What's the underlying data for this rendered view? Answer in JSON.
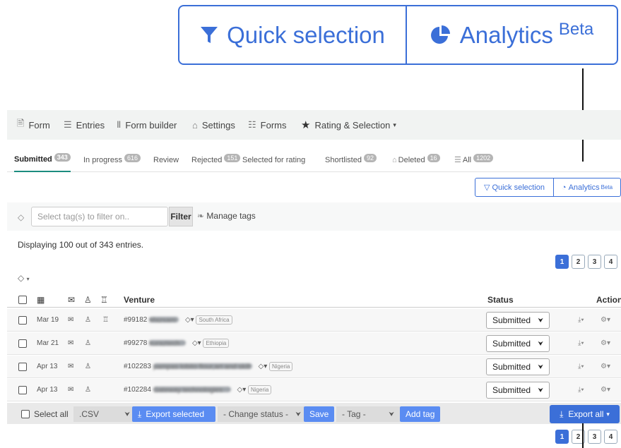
{
  "callout": {
    "quick_selection": "Quick selection",
    "analytics": "Analytics",
    "beta": "Beta"
  },
  "topnav": [
    {
      "label": "Form",
      "icon": "form-icon"
    },
    {
      "label": "Entries",
      "icon": "list-icon"
    },
    {
      "label": "Form builder",
      "icon": "builder-icon"
    },
    {
      "label": "Settings",
      "icon": "lock-icon"
    },
    {
      "label": "Forms",
      "icon": "sitemap-icon"
    },
    {
      "label": "Rating & Selection",
      "icon": "star-icon"
    }
  ],
  "subtabs": [
    {
      "label": "Submitted",
      "count": "343"
    },
    {
      "label": "In progress",
      "count": "616"
    },
    {
      "label": "Review",
      "count": ""
    },
    {
      "label": "Rejected",
      "count": "151"
    },
    {
      "label": "Selected for rating",
      "count": ""
    },
    {
      "label": "Shortlisted",
      "count": "92"
    },
    {
      "label": "Deleted",
      "count": "16"
    },
    {
      "label": "All",
      "count": "1202"
    }
  ],
  "toolbar": {
    "quick_selection": "Quick selection",
    "analytics": "Analytics",
    "beta": "Beta"
  },
  "filter": {
    "placeholder": "Select tag(s) to filter on..",
    "filter_label": "Filter",
    "manage_tags": "Manage tags"
  },
  "summary": "Displaying 100 out of 343 entries.",
  "pages": [
    "1",
    "2",
    "3",
    "4"
  ],
  "table": {
    "venture_header": "Venture",
    "status_header": "Status",
    "action_header": "Action",
    "rows": [
      {
        "date": "Mar 19",
        "id": "#99182",
        "name": "Mazsam",
        "country": "South Africa",
        "status": "Submitted"
      },
      {
        "date": "Mar 21",
        "id": "#99278",
        "name": "kuraztech",
        "country": "Ethiopia",
        "status": "Submitted"
      },
      {
        "date": "Apr 13",
        "id": "#102283",
        "name": "pampas lobito flour,art and skill",
        "country": "Nigeria",
        "status": "Submitted"
      },
      {
        "date": "Apr 13",
        "id": "#102284",
        "name": "Gateway technologies",
        "country": "Nigeria",
        "status": "Submitted"
      }
    ]
  },
  "bulk": {
    "select_all": "Select all",
    "format": ".CSV",
    "export_selected": "Export selected",
    "change_status": "- Change status -",
    "save": "Save",
    "tag": "- Tag -",
    "add_tag": "Add tag",
    "export_all": "Export all"
  },
  "colors": {
    "accent": "#3b6fd8",
    "tab_underline": "#1c8c7f",
    "button_blue": "#5a8cf2"
  }
}
